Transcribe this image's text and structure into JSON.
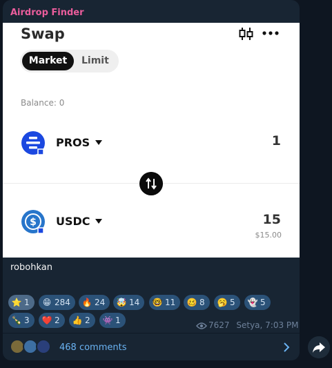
{
  "channel": {
    "name": "Airdrop Finder",
    "name_color": "#ea5d9c"
  },
  "swap_widget": {
    "title": "Swap",
    "tabs": [
      {
        "label": "Market",
        "selected": true
      },
      {
        "label": "Limit",
        "selected": false
      }
    ],
    "balance": "Balance: 0",
    "from_token": {
      "symbol": "PROS",
      "amount": "1",
      "icon": "pros-token-icon"
    },
    "to_token": {
      "symbol": "USDC",
      "amount": "15",
      "usd_value": "$15.00",
      "icon": "usdc-token-icon"
    }
  },
  "post": {
    "caption": "robohkan",
    "views": "7627",
    "signature": "Setya, 7:03 PM"
  },
  "reactions": [
    {
      "emoji": "⭐",
      "count": "1",
      "active": true
    },
    {
      "emoji": "😁",
      "count": "284"
    },
    {
      "emoji": "🔥",
      "count": "24"
    },
    {
      "emoji": "🤯",
      "count": "14"
    },
    {
      "emoji": "🤓",
      "count": "11"
    },
    {
      "emoji": "🥴",
      "count": "8"
    },
    {
      "emoji": "🥱",
      "count": "5"
    },
    {
      "emoji": "👻",
      "count": "5"
    },
    {
      "emoji": "🍾",
      "count": "3"
    },
    {
      "emoji": "❤️",
      "count": "2"
    },
    {
      "emoji": "👍",
      "count": "2"
    },
    {
      "emoji": "👾",
      "count": "1"
    }
  ],
  "comments": {
    "label": "468 comments"
  },
  "colors": {
    "bubble": "#182533",
    "background": "#0e1621",
    "link": "#6ab3f3",
    "reaction": "#2b5278"
  }
}
